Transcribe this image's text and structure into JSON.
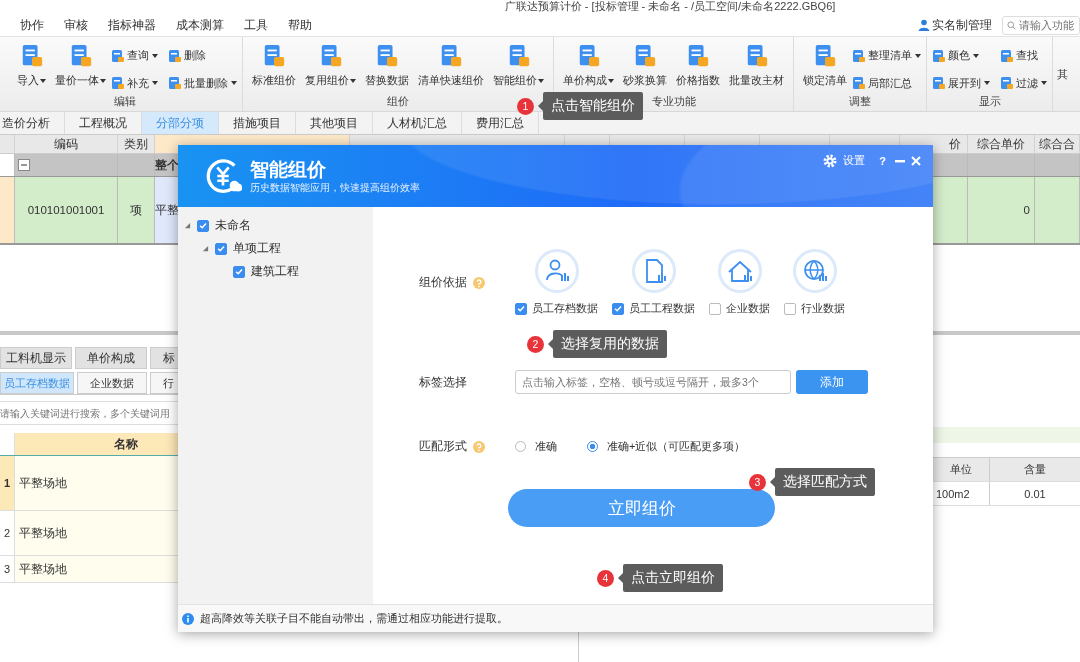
{
  "title": "广联达预算计价 - [投标管理 - 未命名 - /员工空间/未命名2222.GBQ6]",
  "menu": [
    "协作",
    "审核",
    "指标神器",
    "成本测算",
    "工具",
    "帮助"
  ],
  "account": "实名制管理",
  "search": {
    "placeholder": "请输入功能"
  },
  "ribbon": [
    {
      "label": "编辑",
      "large": [
        {
          "label": "导入",
          "dropdown": true
        },
        {
          "label": "量价一体",
          "dropdown": true
        }
      ],
      "small": [
        {
          "label": "查询",
          "dropdown": true
        },
        {
          "label": "补充",
          "dropdown": true
        },
        {
          "label": "删除",
          "dropdown": false
        },
        {
          "label": "批量删除",
          "dropdown": true
        }
      ]
    },
    {
      "label": "组价",
      "large": [
        {
          "label": "标准组价",
          "dropdown": false
        },
        {
          "label": "复用组价",
          "dropdown": true
        },
        {
          "label": "替换数据",
          "dropdown": false
        },
        {
          "label": "清单快速组价",
          "dropdown": false
        },
        {
          "label": "智能组价",
          "dropdown": true
        }
      ]
    },
    {
      "label": "专业功能",
      "large": [
        {
          "label": "单价构成",
          "dropdown": true
        },
        {
          "label": "砂浆换算",
          "dropdown": false
        },
        {
          "label": "价格指数",
          "dropdown": false
        },
        {
          "label": "批量改主材",
          "dropdown": false
        }
      ]
    },
    {
      "label": "调整",
      "large": [
        {
          "label": "锁定清单",
          "dropdown": false
        }
      ],
      "small": [
        {
          "label": "整理清单",
          "dropdown": true
        },
        {
          "label": "局部汇总",
          "dropdown": false
        }
      ]
    },
    {
      "label": "显示",
      "small": [
        {
          "label": "颜色",
          "dropdown": true
        },
        {
          "label": "展开到",
          "dropdown": true
        },
        {
          "label": "查找",
          "dropdown": false
        },
        {
          "label": "过滤",
          "dropdown": true
        }
      ]
    }
  ],
  "ribbon_overflow": "其",
  "tabs": [
    {
      "label": "造价分析",
      "selected": false
    },
    {
      "label": "工程概况",
      "selected": false
    },
    {
      "label": "分部分项",
      "selected": true
    },
    {
      "label": "措施项目",
      "selected": false
    },
    {
      "label": "其他项目",
      "selected": false
    },
    {
      "label": "人材机汇总",
      "selected": false
    },
    {
      "label": "费用汇总",
      "selected": false
    }
  ],
  "table": {
    "columns": [
      "编码",
      "类别",
      "价",
      "综合单价",
      "综合合"
    ],
    "rows": [
      {
        "kind": "group",
        "expanded": true,
        "name": "整个"
      },
      {
        "kind": "item",
        "code": "010101001001",
        "category": "项",
        "name": "平整",
        "comprehensive_unit_price": "0"
      }
    ]
  },
  "lower": {
    "tabs": [
      "工料机显示",
      "单价构成",
      "标"
    ],
    "sources": [
      {
        "label": "员工存档数据",
        "selected": true
      },
      {
        "label": "企业数据",
        "selected": false
      },
      {
        "label": "行",
        "selected": false
      }
    ],
    "search_placeholder": "请输入关键词进行搜索，多个关键词用",
    "grid": {
      "column": "名称",
      "rows": [
        {
          "index": "1",
          "name": "平整场地",
          "selected": true
        },
        {
          "index": "2",
          "name": "平整场地",
          "selected": false
        },
        {
          "index": "3",
          "name": "平整场地",
          "selected": false
        }
      ]
    },
    "detail": {
      "columns": [
        "单位",
        "含量"
      ],
      "rows": [
        [
          "100m2",
          "0.01"
        ]
      ]
    }
  },
  "dialog": {
    "title": "智能组价",
    "subtitle": "历史数据智能应用，快速提高组价效率",
    "settings": "设置",
    "help": "?",
    "tree": [
      {
        "label": "未命名",
        "checked": true,
        "expanded": true,
        "children": [
          {
            "label": "单项工程",
            "checked": true,
            "expanded": true,
            "children": [
              {
                "label": "建筑工程",
                "checked": true
              }
            ]
          }
        ]
      }
    ],
    "basis": {
      "label": "组价依据",
      "sources": [
        {
          "label": "员工存档数据",
          "checked": true
        },
        {
          "label": "员工工程数据",
          "checked": true
        },
        {
          "label": "企业数据",
          "checked": false
        },
        {
          "label": "行业数据",
          "checked": false
        }
      ]
    },
    "tags": {
      "label": "标签选择",
      "placeholder": "点击输入标签，空格、顿号或逗号隔开，最多3个",
      "button": "添加"
    },
    "match": {
      "label": "匹配形式",
      "options": [
        {
          "label": "准确",
          "selected": false
        },
        {
          "label": "准确+近似（可匹配更多项）",
          "selected": true
        }
      ]
    },
    "submit": "立即组价",
    "footer": "超高降效等关联子目不能自动带出，需通过相应功能进行提取。"
  },
  "callouts": [
    {
      "number": "1",
      "text": "点击智能组价"
    },
    {
      "number": "2",
      "text": "选择复用的数据"
    },
    {
      "number": "3",
      "text": "选择匹配方式"
    },
    {
      "number": "4",
      "text": "点击立即组价"
    }
  ]
}
